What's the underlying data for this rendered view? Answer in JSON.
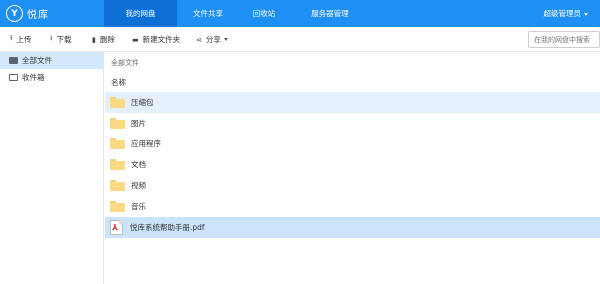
{
  "app": {
    "logo_mark": "Y",
    "logo_text": "悦库"
  },
  "nav": {
    "items": [
      "我的网盘",
      "文件共享",
      "回收站",
      "服务器管理"
    ],
    "user": "超级管理员"
  },
  "toolbar": {
    "upload": "上传",
    "download": "下载",
    "delete": "删除",
    "new_folder": "新建文件夹",
    "share": "分享",
    "search_placeholder": "在我的网盘中搜索"
  },
  "sidebar": {
    "items": [
      "全部文件",
      "收件箱"
    ]
  },
  "main": {
    "breadcrumb": "全部文件",
    "column_name": "名称",
    "files": [
      {
        "name": "压缩包",
        "type": "folder"
      },
      {
        "name": "图片",
        "type": "folder"
      },
      {
        "name": "应用程序",
        "type": "folder"
      },
      {
        "name": "文档",
        "type": "folder"
      },
      {
        "name": "视频",
        "type": "folder"
      },
      {
        "name": "音乐",
        "type": "folder"
      },
      {
        "name": "悦库系统帮助手册.pdf",
        "type": "pdf"
      }
    ]
  },
  "colors": {
    "nav_bg": "#1e8ff5",
    "nav_active": "#0c6fd6",
    "row_hover": "#e4f1fd",
    "row_selected": "#cbe3fb",
    "folder": "#fbd985"
  }
}
